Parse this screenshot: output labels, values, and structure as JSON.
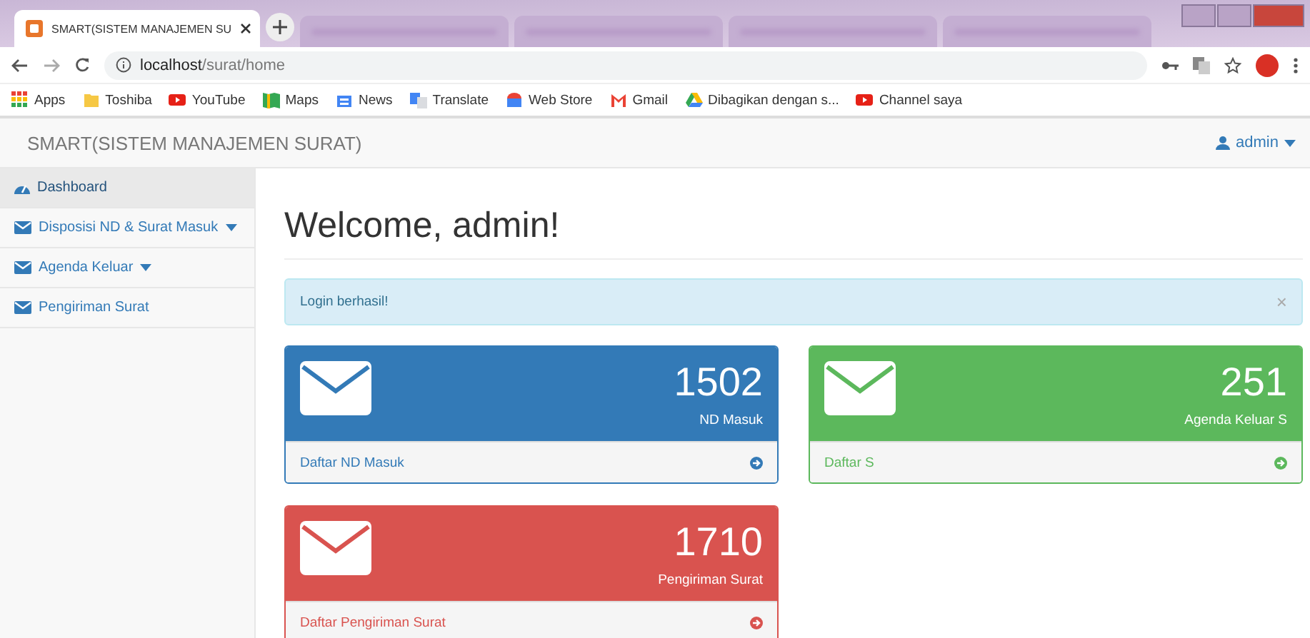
{
  "browser": {
    "tabs": [
      {
        "title": "SMART(SISTEM MANAJEMEN SU",
        "selected": true
      },
      {
        "selected": false
      },
      {
        "selected": false
      },
      {
        "selected": false
      },
      {
        "selected": false
      }
    ],
    "address": {
      "host": "localhost",
      "path": "/surat/home"
    },
    "bookmarks": [
      {
        "label": "Apps",
        "kind": "apps"
      },
      {
        "label": "Toshiba",
        "kind": "folder"
      },
      {
        "label": "YouTube",
        "kind": "youtube"
      },
      {
        "label": "Maps",
        "kind": "maps"
      },
      {
        "label": "News",
        "kind": "news"
      },
      {
        "label": "Translate",
        "kind": "translate"
      },
      {
        "label": "Web Store",
        "kind": "store"
      },
      {
        "label": "Gmail",
        "kind": "gmail"
      },
      {
        "label": "Dibagikan dengan s...",
        "kind": "drive"
      },
      {
        "label": "Channel saya",
        "kind": "youtube"
      }
    ]
  },
  "navbar": {
    "brand": "SMART(SISTEM MANAJEMEN SURAT)",
    "user": "admin"
  },
  "sidebar": {
    "items": [
      {
        "label": "Dashboard",
        "kind": "dashboard",
        "selected": true,
        "dropdown": false
      },
      {
        "label": "Disposisi ND & Surat Masuk",
        "kind": "mail",
        "selected": false,
        "dropdown": true
      },
      {
        "label": "Agenda Keluar",
        "kind": "mail",
        "selected": false,
        "dropdown": true
      },
      {
        "label": "Pengiriman Surat",
        "kind": "mail",
        "selected": false,
        "dropdown": false
      }
    ]
  },
  "page": {
    "heading": "Welcome, admin!",
    "alert": {
      "message": "Login berhasil!",
      "close": "×"
    },
    "panels": [
      {
        "count": "1502",
        "caption": "ND Masuk",
        "link": "Daftar ND Masuk",
        "color": "#337ab7"
      },
      {
        "count": "251",
        "caption": "Agenda Keluar S",
        "link": "Daftar S",
        "color": "#5cb85c"
      },
      {
        "count": "1710",
        "caption": "Pengiriman Surat",
        "link": "Daftar Pengiriman Surat",
        "color": "#d9534f"
      }
    ]
  }
}
